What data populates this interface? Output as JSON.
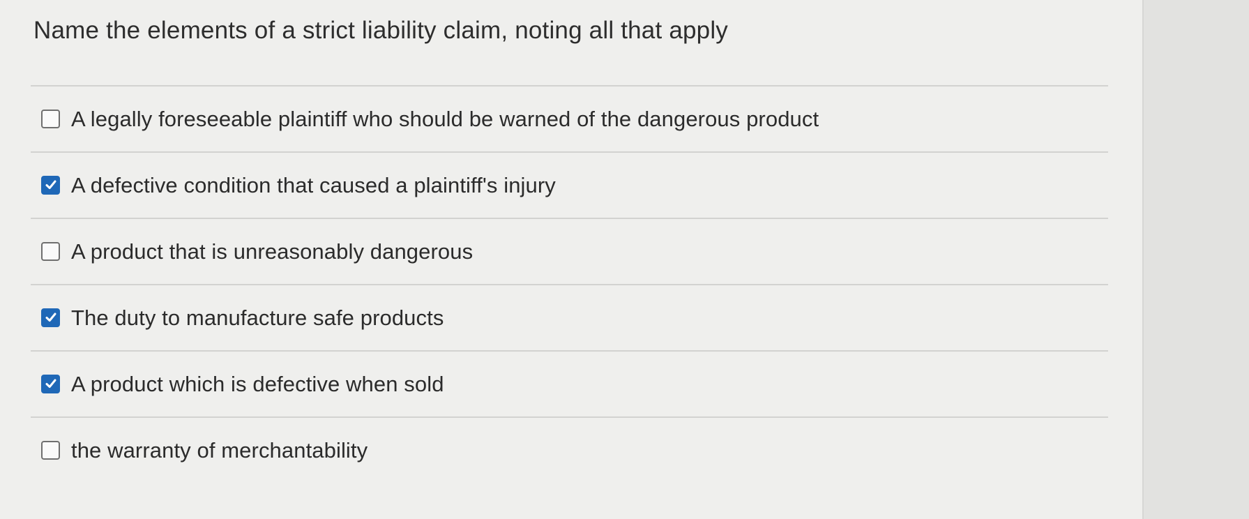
{
  "question": {
    "title": "Name the elements of a strict liability claim, noting all that apply"
  },
  "options": [
    {
      "label": "A legally foreseeable plaintiff who should be warned of the dangerous product",
      "checked": false
    },
    {
      "label": "A defective condition that caused a plaintiff's injury",
      "checked": true
    },
    {
      "label": "A product that is unreasonably dangerous",
      "checked": false
    },
    {
      "label": "The duty to manufacture safe products",
      "checked": true
    },
    {
      "label": "A product which is defective when sold",
      "checked": true
    },
    {
      "label": "the warranty of merchantability",
      "checked": false
    }
  ],
  "colors": {
    "checkbox_checked": "#1f68b7",
    "text": "#2b2b2b"
  },
  "icons": {
    "checkbox_icon": "checkbox-icon",
    "checkmark_icon": "checkmark-icon"
  }
}
